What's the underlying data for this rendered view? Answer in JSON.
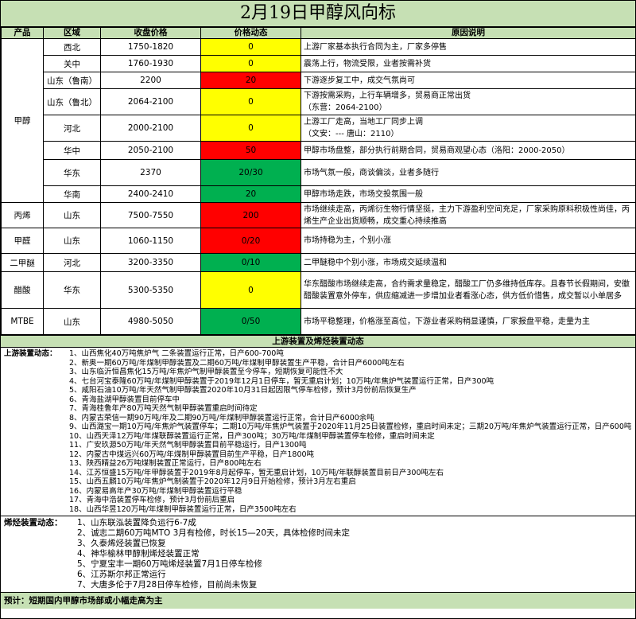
{
  "title": "2月19日甲醇风向标",
  "headers": [
    "产品",
    "区域",
    "收盘价格",
    "价格动态",
    "原因说明"
  ],
  "methanol": {
    "product": "甲醇",
    "rows": [
      {
        "region": "西北",
        "price": "1750-1820",
        "change": "0",
        "color": "yl",
        "reason": "上游厂家基本执行合同为主，厂家多停售"
      },
      {
        "region": "关中",
        "price": "1760-1930",
        "change": "0",
        "color": "yl",
        "reason": "震荡上行，物流受限，业者按需补货"
      },
      {
        "region": "山东（鲁南）",
        "price": "2200",
        "change": "20",
        "color": "rd",
        "reason": "下游逐步复工中，成交气氛尚可"
      },
      {
        "region": "山东（鲁北）",
        "price": "2064-2100",
        "change": "0",
        "color": "yl",
        "reason": "下游按需采购，上行车辆增多，贸易商正常出货\n（东营：2064-2100）"
      },
      {
        "region": "河北",
        "price": "2000-2100",
        "change": "0",
        "color": "yl",
        "reason": "上游工厂走高，当地工厂同步上调\n（文安：---    唐山：2110）"
      },
      {
        "region": "华中",
        "price": "2050-2100",
        "change": "50",
        "color": "rd",
        "reason": "甲醇市场盘整，部分执行前期合同，贸易商观望心态（洛阳：2000-2050）"
      },
      {
        "region": "华东",
        "price": "2370",
        "change": "20/30",
        "color": "gn",
        "reason": "市场气氛一般，商谈偏淡，业者多随行"
      },
      {
        "region": "华南",
        "price": "2400-2410",
        "change": "20",
        "color": "gn",
        "reason": "甲醇市场走跌，市场交投氛围一般"
      }
    ]
  },
  "others": [
    {
      "product": "丙烯",
      "region": "山东",
      "price": "7500-7550",
      "change": "200",
      "color": "rd",
      "reason": "市场继续走高，丙烯衍生物行情坚挺，主力下游盈利空间充足，厂家采购原料积极性尚佳，丙烯生产企业出货顺畅，成交重心持续推高"
    },
    {
      "product": "甲醛",
      "region": "山东",
      "price": "1060-1150",
      "change": "0/20",
      "color": "rd",
      "reason": "市场持稳为主，个别小涨"
    },
    {
      "product": "二甲醚",
      "region": "河北",
      "price": "3200-3350",
      "change": "0/10",
      "color": "gn",
      "reason": "二甲醚稳中个别小涨，市场成交延续温和"
    },
    {
      "product": "醋酸",
      "region": "华东",
      "price": "5300-5350",
      "change": "0",
      "color": "yl",
      "reason": "华东醋酸市场继续走高，合约需求量稳定，醋酸工厂仍多维持低库存。且春节长假期间，安徽醋酸装置意外停车，供应缩减进一步增加业者看涨心态，供方低价惜售，成交暂以小单居多"
    },
    {
      "product": "MTBE",
      "region": "山东",
      "price": "4980-5050",
      "change": "0/50",
      "color": "gn",
      "reason": "市场平稳整理，价格涨至高位，下游业者采购稍显谨慎，厂家报盘平稳，走量为主"
    }
  ],
  "section_title": "上游装置及烯烃装置动态",
  "upstream": {
    "lead": "上游装置动态：",
    "items": [
      "1、山西焦化40万吨焦炉气  二条装置运行正常，日产600-700吨",
      "2、新奥一期60万吨/年煤制甲醇装置及二期60万吨/年煤制甲醇装置生产平稳，合计日产6000吨左右",
      "3、山东临沂恒昌焦化15万吨/年焦炉气制甲醇装置至今停车，短期恢复可能性不大",
      "4、七台河宝泰隆60万吨/年煤制甲醇装置于2019年12月1日停车，暂无重启计划；10万吨/年焦炉气装置运行正常，日产300吨",
      "5、咸阳石油10万吨/年天然气制甲醇装置2020年10月31日起因限气停车检修，预计3月份前后恢复生产",
      "6、青海盐湖甲醇装置目前停车中",
      "7、青海桂鲁年产80万吨天然气制甲醇装置重启时间待定",
      "8、内蒙古荣信一期90万吨/年及二期90万吨/年煤制甲醇装置运行正常，合计日产6000余吨",
      "9、山西潞宝一期10万吨/年焦炉气装置停车；二期10万吨/年焦炉气装置于2020年11月25日装置检修，重启时间未定；三期20万吨/年焦炉气装置运行正常，日产600吨",
      "10、山西天泽12万吨/年煤联醇装置运行正常，日产300吨；30万吨/年煤制甲醇装置停车检修，重启时间未定",
      "11、广安玖源50万吨/年天然气制甲醇装置目前平稳运行，日产1300吨",
      "12、内蒙古中煤远兴60万吨/年煤制甲醇装置目前生产平稳，日产1800吨",
      "13、陕西精益26万吨煤制装置正常运行，日产800吨左右",
      "14、江苏恒盛15万吨/年甲醇装置于2019年8月起停车，暂无重启计划，10万吨/年联醇装置目前日产300吨左右",
      "15、山西五麟10万吨/年焦炉气制装置于2020年12月9日开始检修，预计3月左右重启",
      "16、内蒙易高年产30万吨/年煤制甲醇装置运行平稳",
      "17、青海中浩装置停车检修，预计3月份前后重启",
      "18、山西华昱120万吨/年煤制甲醇装置运行正常，日产3500吨左右"
    ]
  },
  "olefin": {
    "lead": "烯烃装置动态：",
    "items": [
      "1、山东联泓装置降负运行6-7成",
      "2、诚志二期60万吨MTO 3月有检修，时长15—20天，具体检修时间未定",
      "3、久泰烯烃装置已恢复",
      "4、神华榆林甲醇制烯烃装置正常",
      "5、宁夏宝丰一期60万吨烯烃装置7月1日停车检修",
      "6、江苏斯尔邦正常运行",
      "7、大唐多伦于7月28日停车检修，目前尚未恢复"
    ]
  },
  "forecast": "预计：短期国内甲醇市场部或小幅走高为主"
}
